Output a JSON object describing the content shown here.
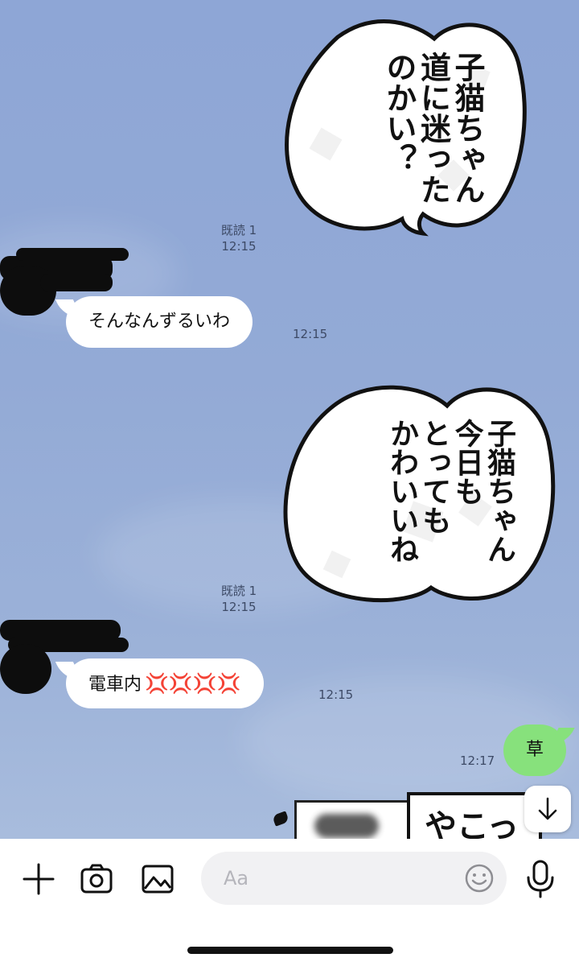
{
  "messages": {
    "sticker1": {
      "lines": [
        "子猫ちゃん",
        "道に迷った",
        "のかい？"
      ],
      "read": "既読 1",
      "time": "12:15"
    },
    "incoming1": {
      "text": "そんなんずるいわ",
      "time": "12:15"
    },
    "sticker2": {
      "lines": [
        "子猫ちゃん",
        "今日も",
        "とっても",
        "かわいいね"
      ],
      "read": "既読 1",
      "time": "12:15"
    },
    "incoming2": {
      "text": "電車内",
      "emoji": "💢💢💢💢",
      "time": "12:15"
    },
    "outgoing1": {
      "text": "草",
      "time": "12:17"
    },
    "partial_sticker": {
      "text": "やこっ"
    }
  },
  "composer": {
    "placeholder": "Aa"
  },
  "icons": [
    "plus-icon",
    "camera-icon",
    "image-icon",
    "emoji-icon",
    "microphone-icon",
    "arrow-down-icon"
  ],
  "colors": {
    "chat_background": "#8fa7d4",
    "outgoing_bubble": "#87e17c",
    "incoming_bubble": "#ffffff"
  }
}
